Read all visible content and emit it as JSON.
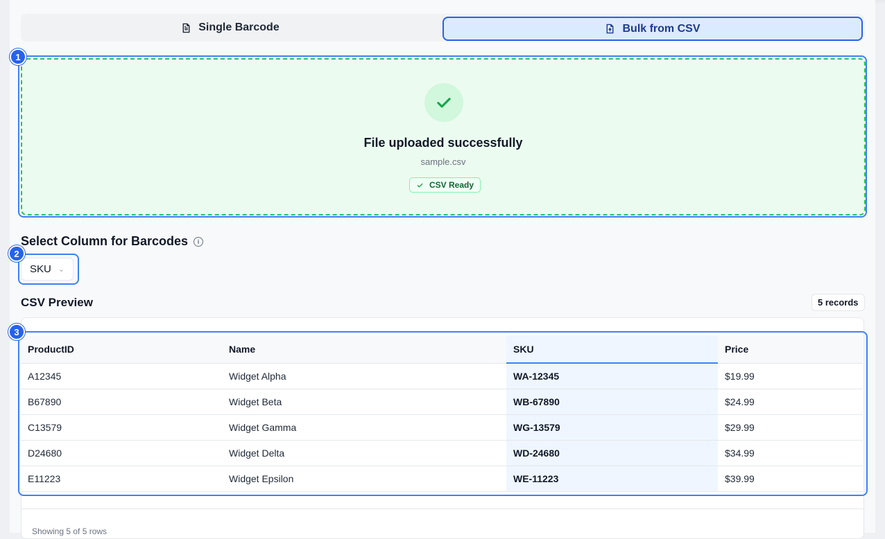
{
  "tabs": {
    "single_label": "Single Barcode",
    "bulk_label": "Bulk from CSV",
    "active": "bulk"
  },
  "markers": [
    "1",
    "2",
    "3"
  ],
  "upload": {
    "title": "File uploaded successfully",
    "filename": "sample.csv",
    "badge": "CSV Ready"
  },
  "column_select": {
    "label": "Select Column for Barcodes",
    "value": "SKU"
  },
  "preview": {
    "title": "CSV Preview",
    "record_count": "5 records",
    "columns": [
      "ProductID",
      "Name",
      "SKU",
      "Price"
    ],
    "highlight_column": "SKU",
    "rows": [
      [
        "A12345",
        "Widget Alpha",
        "WA-12345",
        "$19.99"
      ],
      [
        "B67890",
        "Widget Beta",
        "WB-67890",
        "$24.99"
      ],
      [
        "C13579",
        "Widget Gamma",
        "WG-13579",
        "$29.99"
      ],
      [
        "D24680",
        "Widget Delta",
        "WD-24680",
        "$34.99"
      ],
      [
        "E11223",
        "Widget Epsilon",
        "WE-11223",
        "$39.99"
      ]
    ],
    "footer": "Showing 5 of 5 rows"
  },
  "colors": {
    "accent": "#2563eb",
    "success": "#22c55e",
    "success_bg": "#ecfbf0",
    "highlight_col_bg": "#eff6ff"
  },
  "icons": {
    "single_tab": "document-icon",
    "bulk_tab": "file-upload-icon",
    "upload_status": "check-icon",
    "badge": "check-icon",
    "label_info": "info-icon",
    "select": "chevron-down-icon"
  }
}
